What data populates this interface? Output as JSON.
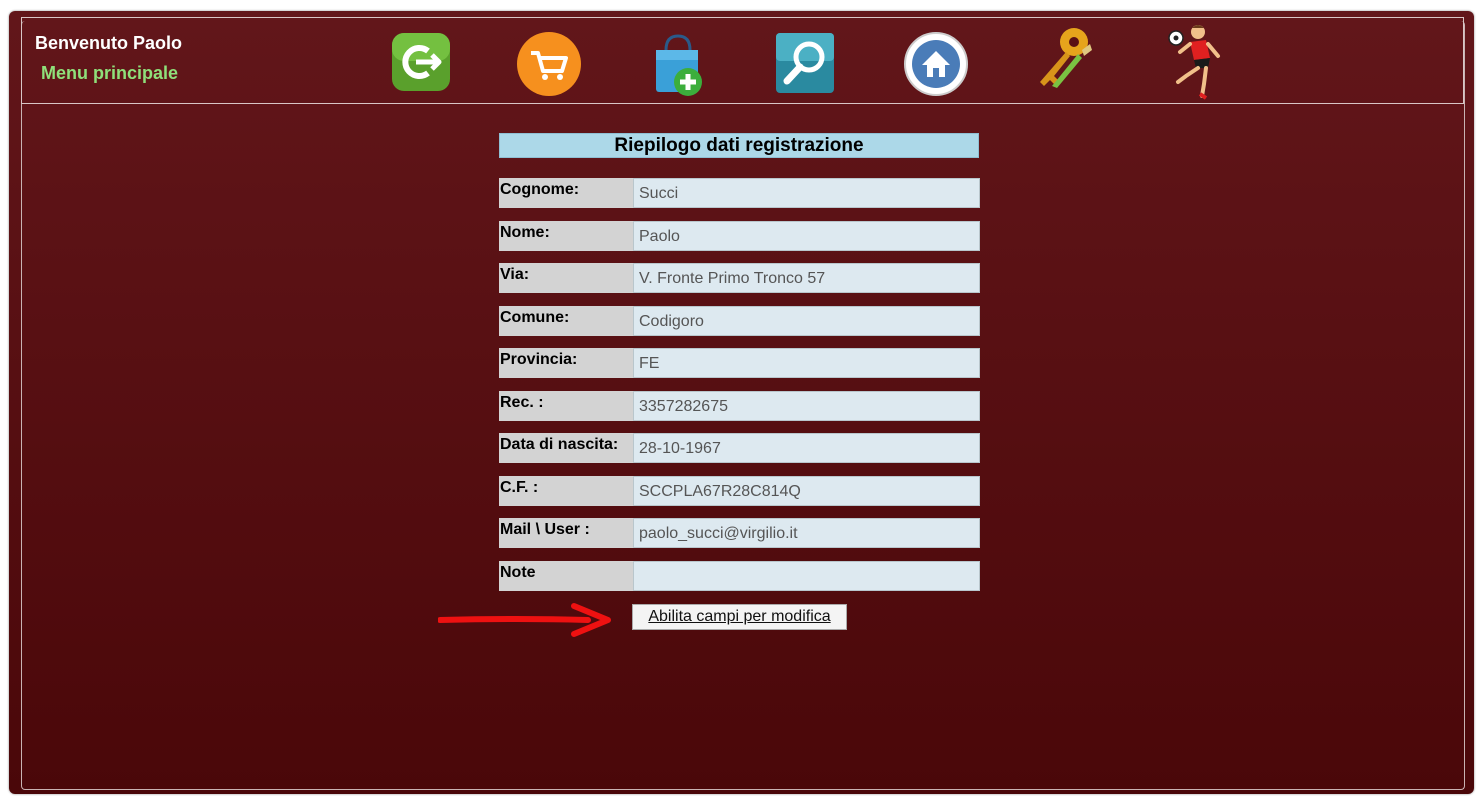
{
  "header": {
    "welcome": "Benvenuto Paolo",
    "menu_label": "Menu principale",
    "icons": [
      "logout-icon",
      "cart-icon",
      "add-bag-icon",
      "search-icon",
      "home-icon",
      "keys-icon",
      "soccer-player-icon"
    ]
  },
  "summary": {
    "title": "Riepilogo dati registrazione",
    "fields": [
      {
        "label": "Cognome:",
        "value": "Succi"
      },
      {
        "label": "Nome:",
        "value": "Paolo"
      },
      {
        "label": "Via:",
        "value": "V. Fronte Primo Tronco 57"
      },
      {
        "label": "Comune:",
        "value": "Codigoro"
      },
      {
        "label": "Provincia:",
        "value": "FE"
      },
      {
        "label": "Rec. :",
        "value": "3357282675"
      },
      {
        "label": "Data di nascita:",
        "value": "28-10-1967"
      },
      {
        "label": "C.F. :",
        "value": "SCCPLA67R28C814Q"
      },
      {
        "label": "Mail \\ User :",
        "value": "paolo_succi@virgilio.it"
      },
      {
        "label": "Note",
        "value": ""
      }
    ],
    "enable_button": "Abilita campi per modifica"
  },
  "colors": {
    "background_top": "#62161a",
    "background_bottom": "#4a0709",
    "menu_link": "#8fe07a",
    "title_bar": "#acd8e8",
    "arrow": "#ee1111"
  }
}
